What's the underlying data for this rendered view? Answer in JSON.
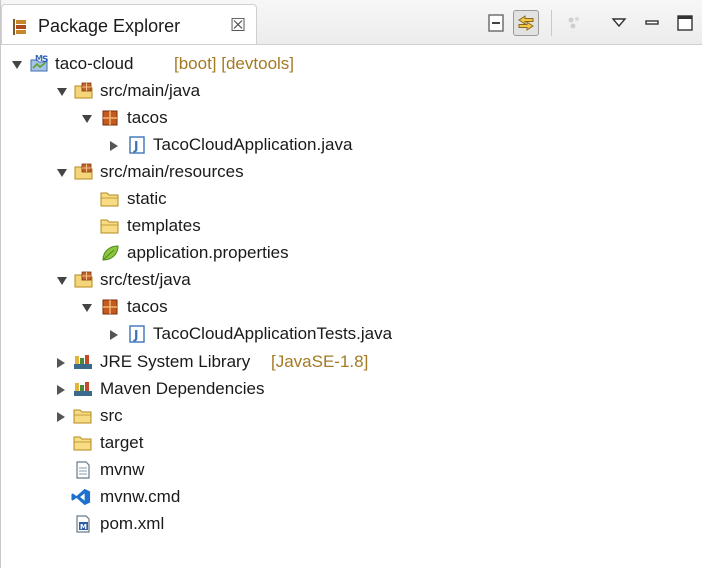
{
  "view": {
    "title": "Package Explorer",
    "close_glyph": "☒",
    "toolbar": {
      "collapse_all": "collapse-all-icon",
      "link_with_editor": "link-with-editor-icon",
      "link_with_editor_pressed": true,
      "focus": "focus-icon",
      "view_menu": "view-menu-icon",
      "minimize": "minimize-icon",
      "maximize": "maximize-icon"
    }
  },
  "tree": {
    "project": {
      "name": "taco-cloud",
      "decoration": "[boot] [devtools]",
      "icon": "spring-boot-project-icon",
      "expanded": true
    },
    "src_main_java": {
      "name": "src/main/java",
      "icon": "source-folder-icon",
      "expanded": true
    },
    "tacos_main": {
      "name": "tacos",
      "icon": "package-icon",
      "expanded": true
    },
    "app_java": {
      "name": "TacoCloudApplication.java",
      "icon": "java-file-icon",
      "expanded": false
    },
    "src_main_resources": {
      "name": "src/main/resources",
      "icon": "source-folder-icon",
      "expanded": true
    },
    "static": {
      "name": "static",
      "icon": "folder-icon"
    },
    "templates": {
      "name": "templates",
      "icon": "folder-icon"
    },
    "app_props": {
      "name": "application.properties",
      "icon": "properties-file-icon"
    },
    "src_test_java": {
      "name": "src/test/java",
      "icon": "source-folder-icon",
      "expanded": true
    },
    "tacos_test": {
      "name": "tacos",
      "icon": "package-icon",
      "expanded": true
    },
    "tests_java": {
      "name": "TacoCloudApplicationTests.java",
      "icon": "java-file-icon",
      "expanded": false
    },
    "jre": {
      "name": "JRE System Library",
      "decoration": "[JavaSE-1.8]",
      "icon": "library-icon",
      "expanded": false
    },
    "maven": {
      "name": "Maven Dependencies",
      "icon": "library-icon",
      "expanded": false
    },
    "src": {
      "name": "src",
      "icon": "folder-icon",
      "expanded": false
    },
    "target": {
      "name": "target",
      "icon": "folder-icon"
    },
    "mvnw": {
      "name": "mvnw",
      "icon": "text-file-icon"
    },
    "mvnw_cmd": {
      "name": "mvnw.cmd",
      "icon": "vscode-file-icon"
    },
    "pom": {
      "name": "pom.xml",
      "icon": "maven-pom-icon"
    }
  },
  "colors": {
    "decoration": "#a47a23",
    "folder": "#f1c44a",
    "package": "#b04a1a",
    "java": "#3a73b8"
  }
}
